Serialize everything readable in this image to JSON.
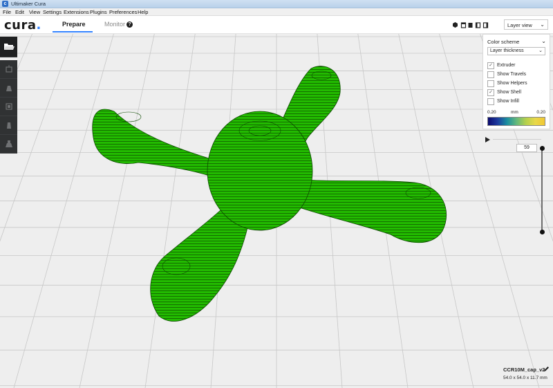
{
  "window": {
    "title": "Ultimaker Cura",
    "icon": "cura-app-icon"
  },
  "menu": [
    "File",
    "Edit",
    "View",
    "Settings",
    "Extensions",
    "Plugins",
    "Preferences",
    "Help"
  ],
  "header": {
    "logo": "cura",
    "tabs": [
      {
        "label": "Prepare",
        "active": true
      },
      {
        "label": "Monitor",
        "active": false
      }
    ],
    "help_icon": "question-circle-icon",
    "view_buttons": [
      "3d-view-icon",
      "front-view-icon",
      "top-view-icon",
      "left-view-icon",
      "right-view-icon"
    ],
    "view_mode": "Layer view"
  },
  "toolbar": {
    "buttons": [
      "open-file-icon",
      "move-icon",
      "scale-icon",
      "rotate-icon",
      "mirror-icon",
      "per-model-settings-icon"
    ]
  },
  "layer_panel": {
    "title": "Color scheme",
    "scheme": "Layer thickness",
    "options": [
      {
        "label": "Extruder",
        "checked": true
      },
      {
        "label": "Show Travels",
        "checked": false
      },
      {
        "label": "Show Helpers",
        "checked": false
      },
      {
        "label": "Show Shell",
        "checked": true
      },
      {
        "label": "Show Infill",
        "checked": false
      }
    ],
    "scale_min": "0.20",
    "scale_unit": "mm",
    "scale_max": "0.20"
  },
  "layer_slider": {
    "value": "59"
  },
  "object": {
    "name": "CCR10M_cap_v2",
    "dimensions": "54.0 x 54.0 x 11.7 mm"
  },
  "colors": {
    "model": "#22bb00",
    "accent": "#3282ff",
    "toolbar": "#303233"
  }
}
